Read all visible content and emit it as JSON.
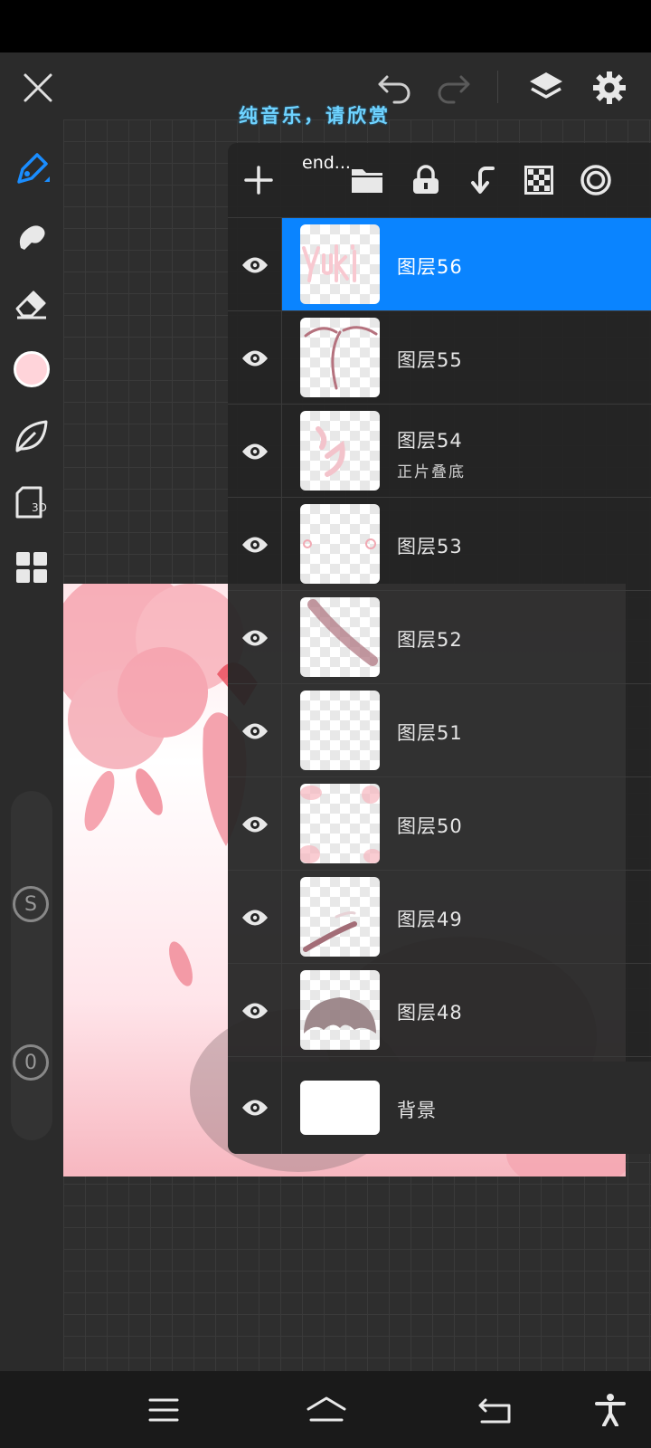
{
  "app": {
    "overlay_caption": "纯音乐，请欣赏"
  },
  "layer_panel": {
    "title": "end...",
    "layers": [
      {
        "name": "图层56",
        "selected": true,
        "sub": ""
      },
      {
        "name": "图层55",
        "selected": false,
        "sub": ""
      },
      {
        "name": "图层54",
        "selected": false,
        "sub": "正片叠底"
      },
      {
        "name": "图层53",
        "selected": false,
        "sub": ""
      },
      {
        "name": "图层52",
        "selected": false,
        "sub": ""
      },
      {
        "name": "图层51",
        "selected": false,
        "sub": ""
      },
      {
        "name": "图层50",
        "selected": false,
        "sub": ""
      },
      {
        "name": "图层49",
        "selected": false,
        "sub": ""
      },
      {
        "name": "图层48",
        "selected": false,
        "sub": ""
      }
    ],
    "background_layer": {
      "name": "背景"
    }
  },
  "left_toolbar": {
    "current_color": "#ffd4da",
    "size_knob_label": "S",
    "opacity_knob_label": "0"
  },
  "colors": {
    "accent": "#0a84ff",
    "toolbar_bg": "#2b2b2b"
  }
}
